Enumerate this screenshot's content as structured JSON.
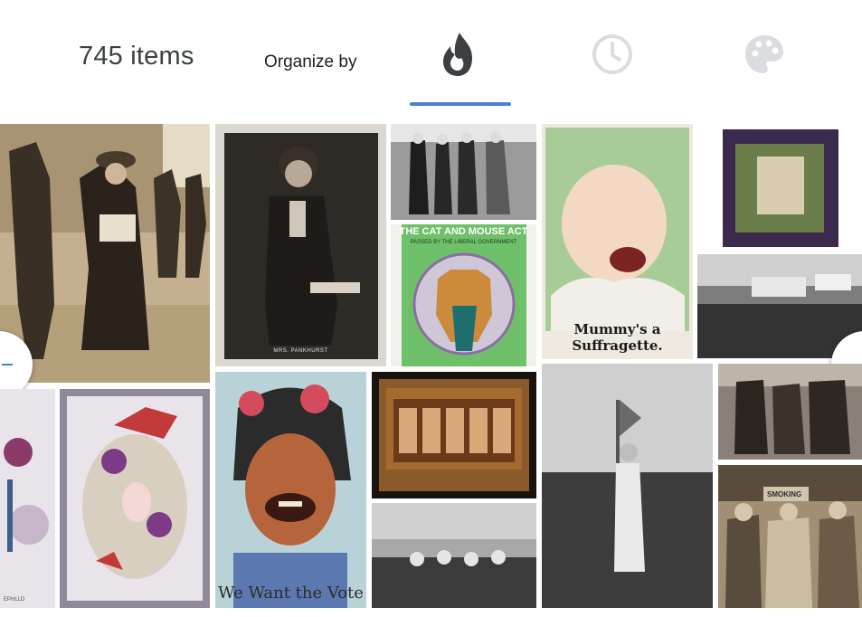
{
  "header": {
    "item_count": "745 items",
    "organize_label": "Organize by",
    "tabs": [
      {
        "icon": "flame-icon",
        "active": true
      },
      {
        "icon": "clock-icon",
        "active": false
      },
      {
        "icon": "palette-icon",
        "active": false
      }
    ],
    "accent_color": "#4a7fd9"
  },
  "grid": {
    "captions": {
      "pankhurst": "MRS. PANKHURST",
      "cat_title": "THE CAT AND MOUSE ACT",
      "cat_sub": "PASSED BY THE LIBERAL GOVERNMENT",
      "mummy": "Mummy's a Suffragette.",
      "vote": "We Want the Vote",
      "smoking": "SMOKING",
      "postcard_corner": "EPHLLD"
    }
  },
  "nav": {
    "prev_icon": "chevron-left-icon",
    "next_icon": "chevron-right-icon"
  }
}
